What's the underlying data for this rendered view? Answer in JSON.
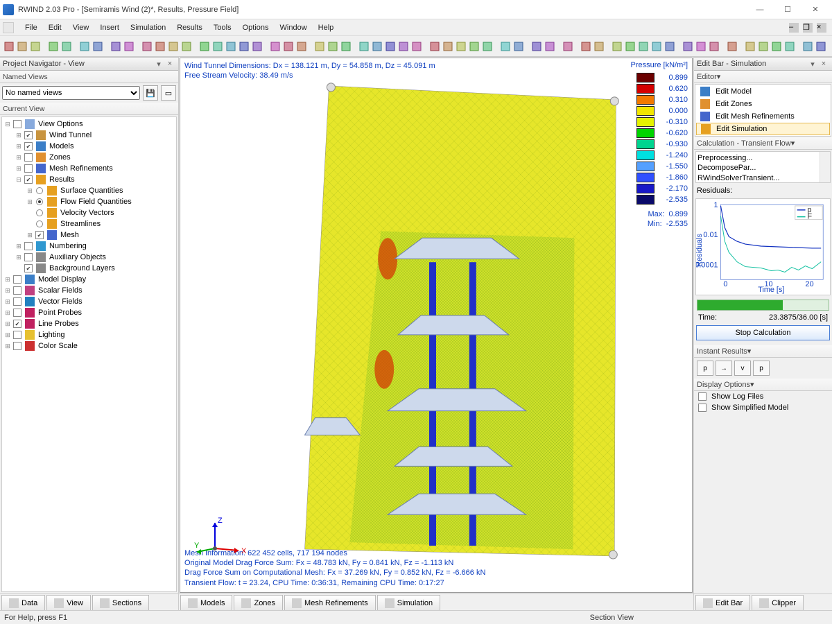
{
  "title": "RWIND 2.03 Pro - [Semiramis Wind (2)*, Results, Pressure Field]",
  "menu": [
    "File",
    "Edit",
    "View",
    "Insert",
    "Simulation",
    "Results",
    "Tools",
    "Options",
    "Window",
    "Help"
  ],
  "left": {
    "title": "Project Navigator - View",
    "named_views_label": "Named Views",
    "no_named_views": "No named views",
    "current_view_label": "Current View",
    "tree": [
      {
        "d": 0,
        "tw": "-",
        "cb": "",
        "ico": "op",
        "label": "View Options"
      },
      {
        "d": 1,
        "tw": "+",
        "cb": "ck",
        "ico": "wt",
        "label": "Wind Tunnel"
      },
      {
        "d": 1,
        "tw": "+",
        "cb": "ck",
        "ico": "md",
        "label": "Models"
      },
      {
        "d": 1,
        "tw": "+",
        "cb": "",
        "ico": "zn",
        "label": "Zones"
      },
      {
        "d": 1,
        "tw": "+",
        "cb": "",
        "ico": "mr",
        "label": "Mesh Refinements"
      },
      {
        "d": 1,
        "tw": "-",
        "cb": "ck",
        "ico": "rs",
        "label": "Results"
      },
      {
        "d": 2,
        "tw": "+",
        "rb": "",
        "ico": "sq",
        "label": "Surface Quantities"
      },
      {
        "d": 2,
        "tw": "+",
        "rb": "ck",
        "ico": "ff",
        "label": "Flow Field Quantities"
      },
      {
        "d": 2,
        "tw": "",
        "rb": "",
        "ico": "vv",
        "label": "Velocity Vectors"
      },
      {
        "d": 2,
        "tw": "",
        "rb": "",
        "ico": "sl",
        "label": "Streamlines"
      },
      {
        "d": 2,
        "tw": "+",
        "cb": "ck",
        "ico": "ms",
        "label": "Mesh"
      },
      {
        "d": 1,
        "tw": "+",
        "cb": "",
        "ico": "nm",
        "label": "Numbering"
      },
      {
        "d": 1,
        "tw": "+",
        "cb": "",
        "ico": "ao",
        "label": "Auxiliary Objects"
      },
      {
        "d": 1,
        "tw": "",
        "cb": "ck",
        "ico": "bl",
        "label": "Background Layers"
      },
      {
        "d": 0,
        "tw": "+",
        "cb": "",
        "ico": "mdsp",
        "label": "Model Display"
      },
      {
        "d": 0,
        "tw": "+",
        "cb": "",
        "ico": "sf",
        "label": "Scalar Fields"
      },
      {
        "d": 0,
        "tw": "+",
        "cb": "",
        "ico": "vf",
        "label": "Vector Fields"
      },
      {
        "d": 0,
        "tw": "+",
        "cb": "",
        "ico": "pp",
        "label": "Point Probes"
      },
      {
        "d": 0,
        "tw": "+",
        "cb": "ck",
        "ico": "lp",
        "label": "Line Probes"
      },
      {
        "d": 0,
        "tw": "+",
        "cb": "",
        "ico": "lt",
        "label": "Lighting"
      },
      {
        "d": 0,
        "tw": "+",
        "cb": "",
        "ico": "cs",
        "label": "Color Scale"
      }
    ]
  },
  "bottom_tabs_left": [
    "Data",
    "View",
    "Sections"
  ],
  "bottom_tabs_mid": [
    "Models",
    "Zones",
    "Mesh Refinements",
    "Simulation"
  ],
  "bottom_tabs_right": [
    "Edit Bar",
    "Clipper"
  ],
  "viewport": {
    "top1": "Wind Tunnel Dimensions: Dx = 138.121 m, Dy = 54.858 m, Dz = 45.091 m",
    "top2": "Free Stream Velocity: 38.49 m/s",
    "bot1": "Mesh Information: 622 452 cells, 717 194 nodes",
    "bot2": "Original Model Drag Force Sum: Fx = 48.783 kN, Fy = 0.841 kN, Fz = -1.113 kN",
    "bot3": "Drag Force Sum on Computational Mesh: Fx = 37.269 kN, Fy = 0.852 kN, Fz = -6.666 kN",
    "bot4": "Transient Flow: t = 23.24, CPU Time: 0:36:31, Remaining CPU Time: 0:17:27",
    "legend_title": "Pressure [kN/m²]",
    "legend": [
      {
        "c": "#6b0000",
        "v": "0.899"
      },
      {
        "c": "#d40000",
        "v": "0.620"
      },
      {
        "c": "#f27900",
        "v": "0.310"
      },
      {
        "c": "#f2e600",
        "v": "0.000"
      },
      {
        "c": "#e5f200",
        "v": "-0.310"
      },
      {
        "c": "#00d400",
        "v": "-0.620"
      },
      {
        "c": "#00d48f",
        "v": "-0.930"
      },
      {
        "c": "#00e0e0",
        "v": "-1.240"
      },
      {
        "c": "#55a0ff",
        "v": "-1.550"
      },
      {
        "c": "#3050ff",
        "v": "-1.860"
      },
      {
        "c": "#1818c8",
        "v": "-2.170"
      },
      {
        "c": "#0a0a6a",
        "v": "-2.535"
      }
    ],
    "max_label": "Max:",
    "max_val": "0.899",
    "min_label": "Min:",
    "min_val": "-2.535"
  },
  "right": {
    "title": "Edit Bar - Simulation",
    "editor_label": "Editor",
    "editor_items": [
      "Edit Model",
      "Edit Zones",
      "Edit Mesh Refinements",
      "Edit Simulation"
    ],
    "calc_label": "Calculation - Transient Flow",
    "log": [
      "Preprocessing...",
      "DecomposePar...",
      "RWindSolverTransient..."
    ],
    "residuals_label": "Residuals:",
    "time_label": "Time:",
    "time_value": "23.3875/36.00 [s]",
    "stop_label": "Stop Calculation",
    "instant_label": "Instant Results",
    "instant_btns": [
      "p",
      "→",
      "v",
      "p"
    ],
    "display_label": "Display Options",
    "display_options": [
      "Show Log Files",
      "Show Simplified Model"
    ]
  },
  "chart_data": {
    "type": "line",
    "title": "",
    "xlabel": "Time [s]",
    "ylabel": "Residuals",
    "ylim": [
      3e-05,
      1
    ],
    "xlim": [
      0,
      25
    ],
    "yscale": "log",
    "yticks": [
      1,
      0.01,
      0.0001
    ],
    "xticks": [
      0,
      10,
      20
    ],
    "series": [
      {
        "name": "p",
        "color": "#1030c0",
        "x": [
          0,
          1,
          2,
          4,
          6,
          10,
          14,
          18,
          22,
          24
        ],
        "y": [
          0.9,
          0.05,
          0.012,
          0.006,
          0.004,
          0.003,
          0.0028,
          0.0025,
          0.0024,
          0.0024
        ]
      },
      {
        "name": "F",
        "color": "#10c0a0",
        "x": [
          0,
          1,
          2,
          4,
          6,
          10,
          14,
          18,
          22,
          24
        ],
        "y": [
          0.2,
          0.006,
          0.001,
          0.0003,
          0.00015,
          0.00012,
          0.0001,
          0.00012,
          0.00015,
          0.0003
        ]
      }
    ]
  },
  "status_left": "For Help, press F1",
  "status_right": "Section View",
  "axis": {
    "x": "X",
    "y": "Y",
    "z": "Z"
  }
}
